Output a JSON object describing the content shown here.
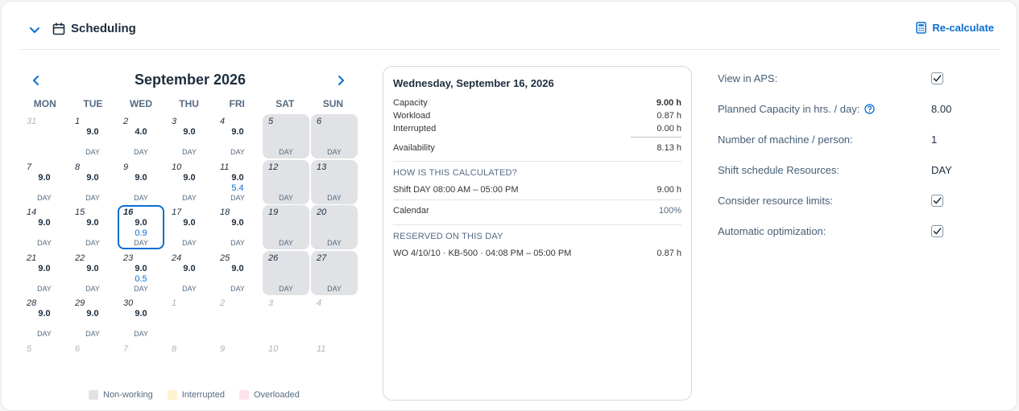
{
  "header": {
    "title": "Scheduling",
    "recalculate_label": "Re-calculate"
  },
  "calendar": {
    "month_title": "September 2026",
    "weekdays": [
      "MON",
      "TUE",
      "WED",
      "THU",
      "FRI",
      "SAT",
      "SUN"
    ],
    "weeks": [
      [
        {
          "day": "31",
          "outside": true
        },
        {
          "day": "1",
          "cap": "9.0",
          "shift": "DAY"
        },
        {
          "day": "2",
          "cap": "4.0",
          "shift": "DAY"
        },
        {
          "day": "3",
          "cap": "9.0",
          "shift": "DAY"
        },
        {
          "day": "4",
          "cap": "9.0",
          "shift": "DAY"
        },
        {
          "day": "5",
          "nonworking": true,
          "shift": "DAY"
        },
        {
          "day": "6",
          "nonworking": true,
          "shift": "DAY"
        }
      ],
      [
        {
          "day": "7",
          "cap": "9.0",
          "shift": "DAY"
        },
        {
          "day": "8",
          "cap": "9.0",
          "shift": "DAY"
        },
        {
          "day": "9",
          "cap": "9.0",
          "shift": "DAY"
        },
        {
          "day": "10",
          "cap": "9.0",
          "shift": "DAY"
        },
        {
          "day": "11",
          "cap": "9.0",
          "load": "5.4",
          "shift": "DAY"
        },
        {
          "day": "12",
          "nonworking": true,
          "shift": "DAY"
        },
        {
          "day": "13",
          "nonworking": true,
          "shift": "DAY"
        }
      ],
      [
        {
          "day": "14",
          "cap": "9.0",
          "shift": "DAY"
        },
        {
          "day": "15",
          "cap": "9.0",
          "shift": "DAY"
        },
        {
          "day": "16",
          "cap": "9.0",
          "load": "0.9",
          "shift": "DAY",
          "selected": true
        },
        {
          "day": "17",
          "cap": "9.0",
          "shift": "DAY"
        },
        {
          "day": "18",
          "cap": "9.0",
          "shift": "DAY"
        },
        {
          "day": "19",
          "nonworking": true,
          "shift": "DAY"
        },
        {
          "day": "20",
          "nonworking": true,
          "shift": "DAY"
        }
      ],
      [
        {
          "day": "21",
          "cap": "9.0",
          "shift": "DAY"
        },
        {
          "day": "22",
          "cap": "9.0",
          "shift": "DAY"
        },
        {
          "day": "23",
          "cap": "9.0",
          "load": "0.5",
          "shift": "DAY"
        },
        {
          "day": "24",
          "cap": "9.0",
          "shift": "DAY"
        },
        {
          "day": "25",
          "cap": "9.0",
          "shift": "DAY"
        },
        {
          "day": "26",
          "nonworking": true,
          "shift": "DAY"
        },
        {
          "day": "27",
          "nonworking": true,
          "shift": "DAY"
        }
      ],
      [
        {
          "day": "28",
          "cap": "9.0",
          "shift": "DAY"
        },
        {
          "day": "29",
          "cap": "9.0",
          "shift": "DAY"
        },
        {
          "day": "30",
          "cap": "9.0",
          "shift": "DAY"
        },
        {
          "day": "1",
          "outside": true
        },
        {
          "day": "2",
          "outside": true
        },
        {
          "day": "3",
          "outside": true
        },
        {
          "day": "4",
          "outside": true
        }
      ],
      [
        {
          "day": "5",
          "outside": true
        },
        {
          "day": "6",
          "outside": true
        },
        {
          "day": "7",
          "outside": true
        },
        {
          "day": "8",
          "outside": true
        },
        {
          "day": "9",
          "outside": true
        },
        {
          "day": "10",
          "outside": true
        },
        {
          "day": "11",
          "outside": true
        }
      ]
    ],
    "legend": [
      {
        "label": "Non-working",
        "color": "#e0e2e5"
      },
      {
        "label": "Interrupted",
        "color": "#fff3cd"
      },
      {
        "label": "Overloaded",
        "color": "#fde4ec"
      }
    ]
  },
  "detail": {
    "date_title": "Wednesday, September 16, 2026",
    "capacity_label": "Capacity",
    "capacity_value": "9.00 h",
    "workload_label": "Workload",
    "workload_value": "0.87 h",
    "interrupted_label": "Interrupted",
    "interrupted_value": "0.00 h",
    "availability_label": "Availability",
    "availability_value": "8.13 h",
    "calc_section_title": "HOW IS THIS CALCULATED?",
    "calc_rows": [
      {
        "label": "Shift DAY 08:00 AM – 05:00 PM",
        "value": "9.00 h",
        "muted": false
      },
      {
        "label": "Calendar",
        "value": "100%",
        "muted": true
      }
    ],
    "reserved_section_title": "RESERVED ON THIS DAY",
    "reserved_rows": [
      {
        "label": "WO 4/10/10 · KB-500 · 04:08 PM – 05:00 PM",
        "value": "0.87 h"
      }
    ]
  },
  "settings": {
    "view_in_aps_label": "View in APS:",
    "view_in_aps_checked": true,
    "planned_capacity_label": "Planned Capacity in hrs. / day:",
    "planned_capacity_value": "8.00",
    "machines_label": "Number of machine / person:",
    "machines_value": "1",
    "shift_label": "Shift schedule Resources:",
    "shift_value": "DAY",
    "resource_limits_label": "Consider resource limits:",
    "resource_limits_checked": true,
    "auto_opt_label": "Automatic optimization:",
    "auto_opt_checked": true
  },
  "colors": {
    "accent": "#0a6ed1",
    "nonworking": "#e0e2e5"
  }
}
